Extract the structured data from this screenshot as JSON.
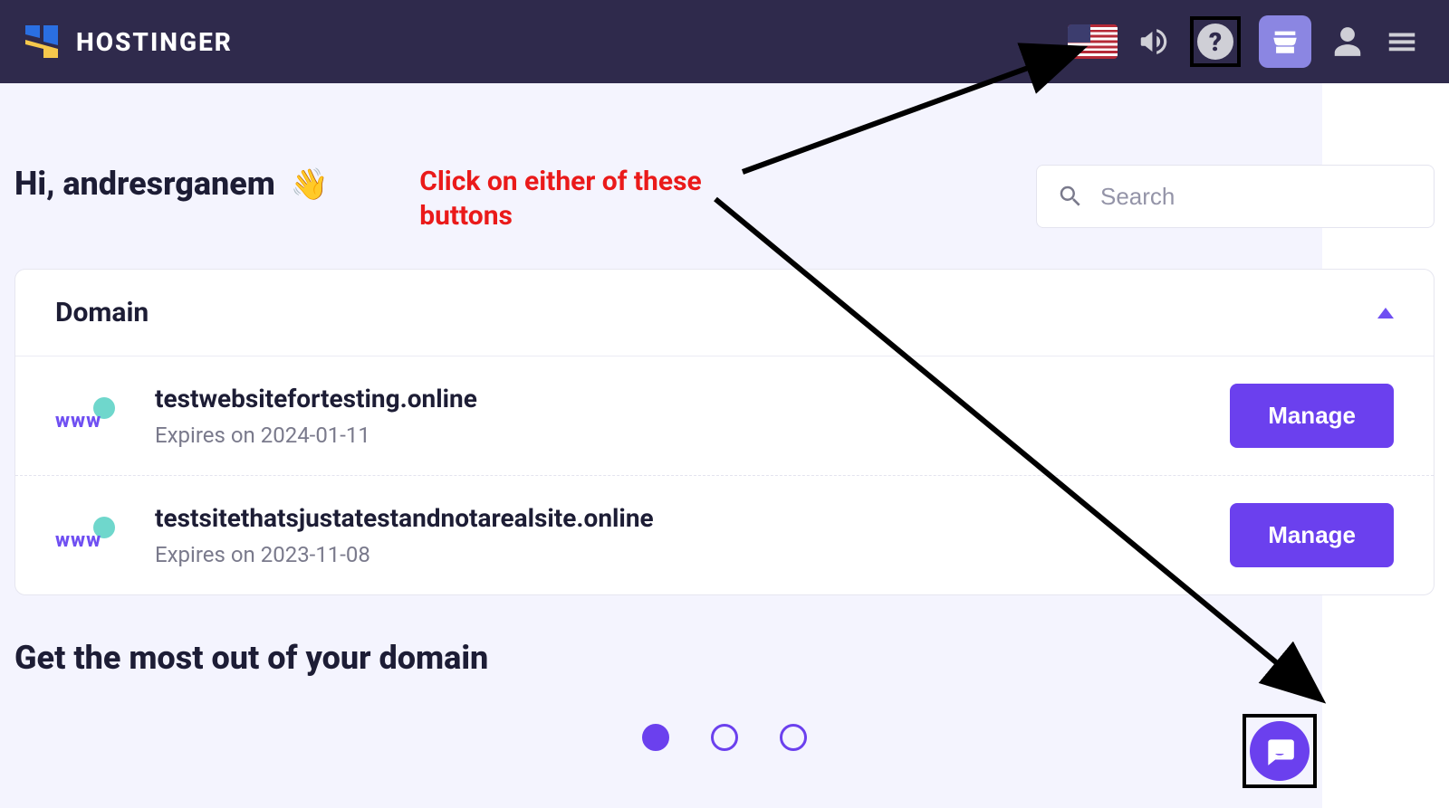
{
  "header": {
    "brand": "HOSTINGER"
  },
  "greeting": {
    "prefix": "Hi, ",
    "username": "andresrganem",
    "emoji": "👋"
  },
  "annotation": "Click on either of these buttons",
  "search": {
    "placeholder": "Search"
  },
  "domain_panel": {
    "title": "Domain",
    "items": [
      {
        "name": "testwebsitefortesting.online",
        "expires": "Expires on 2024-01-11",
        "button": "Manage"
      },
      {
        "name": "testsitethatsjustatestandnotarealsite.online",
        "expires": "Expires on 2023-11-08",
        "button": "Manage"
      }
    ]
  },
  "subheading": "Get the most out of your domain",
  "pagination": {
    "active_index": 0,
    "total": 3
  }
}
